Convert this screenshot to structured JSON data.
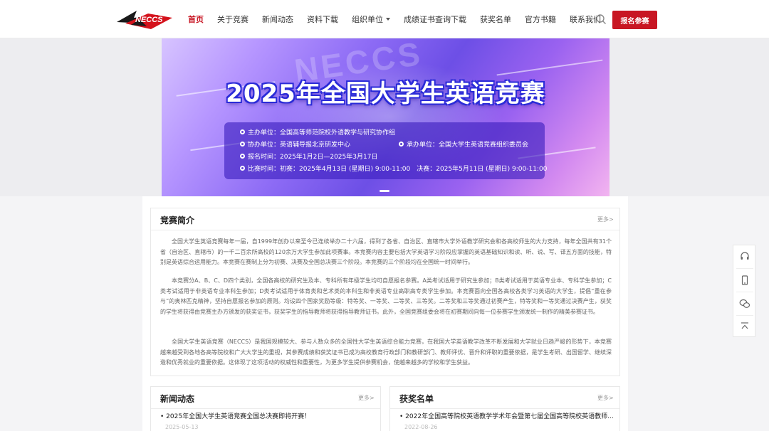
{
  "header": {
    "logo_text": "NECCS",
    "nav": [
      {
        "label": "首页",
        "active": true
      },
      {
        "label": "关于竞赛"
      },
      {
        "label": "新闻动态"
      },
      {
        "label": "资料下载"
      },
      {
        "label": "组织单位",
        "dropdown": true
      },
      {
        "label": "成绩证书查询下载"
      },
      {
        "label": "获奖名单"
      },
      {
        "label": "官方书籍"
      },
      {
        "label": "联系我们"
      }
    ],
    "signup_label": "报名参赛",
    "accent_color": "#c81623"
  },
  "banner": {
    "watermark": "NECCS",
    "title": "2025年全国大学生英语竞赛",
    "lines": {
      "host": "主办单位：全国高等师范院校外语教学与研究协作组",
      "assist": "协办单位：英语辅导报北京研发中心",
      "organizer": "承办单位：全国大学生英语竞赛组织委员会",
      "register": "报名时间：2025年1月2日—2025年3月17日",
      "exam": "比赛时间：初赛：2025年4月13日 (星期日) 9:00-11:00　决赛：2025年5月11日 (星期日) 9:00-11:00"
    }
  },
  "intro": {
    "title": "竞赛简介",
    "more": "更多>",
    "paragraphs": [
      "全国大学生英语竞赛每年一届，自1999年创办以来至今已连续举办二十六届，得到了各省、自治区、直辖市大学外语教学研究会和各高校师生的大力支持，每年全国共有31个省（自治区、直辖市）的一千二百余所高校的120余万大学生参加此项赛事。本竞赛内容主要包括大学英语学习阶段应掌握的英语基础知识和读、听、说、写、译五方面的技能，特别是英语综合运用能力。本竞赛在赛制上分为初赛、决赛及全国总决赛三个阶段。本竞赛的三个阶段均在全国统一时间举行。",
      "本竞赛分A、B、C、D四个类别，全国各高校的研究生及本、专科所有年级学生均可自愿报名参赛。A类考试适用于研究生参加；B类考试适用于英语专业本、专科学生参加；C类考试适用于非英语专业本科生参加；D类考试适用于体育类和艺术类的本科生和非英语专业高职高专类学生参加。本竞赛面向全国各高校各类学习英语的大学生，提倡“重在参与”的奥林匹克精神，坚持自愿报名参加的原则。均设四个国家奖励等级：特等奖、一等奖、二等奖、三等奖。二等奖和三等奖通过初赛产生，特等奖和一等奖通过决赛产生，获奖的学生将获得由竞赛主办方颁发的获奖证书，获奖学生的指导教师将获得指导教师证书。此外，全国竞赛组委会将在初赛期间向每一位参赛学生颁发统一制作的精美参赛证书。",
      "全国大学生英语竞赛（NECCS）是我国规模较大、参与人数众多的全国性大学生英语综合能力竞赛，在我国大学英语教学改革不断发展和大学就业日趋严峻的形势下，本竞赛越来越受到各地各高等院校和广大大学生的重视，其参赛成绩和获奖证书已成为高校教育行政部门和教研部门、教师评优、晋升和评职的重要依据，是学生考研、出国留学、继续深造和优秀就业的重要依据。这体现了这项活动的权威性和重要性，为更多学生提供参赛机会，使越来越多的学校和学生获益。"
    ]
  },
  "news": {
    "title": "新闻动态",
    "more": "更多>",
    "item": "• 2025年全国大学生英语竞赛全国总决赛即将开赛！",
    "date": "2025-05-13"
  },
  "awards": {
    "title": "获奖名单",
    "more": "更多>",
    "item": "• 2022年全国高等院校英语教学学术年会暨第七届全国高等院校英语教师…",
    "date": "2022-08-26"
  },
  "float_bar": {
    "icons": [
      "headset-icon",
      "mobile-icon",
      "wechat-icon",
      "back-to-top-icon"
    ]
  }
}
